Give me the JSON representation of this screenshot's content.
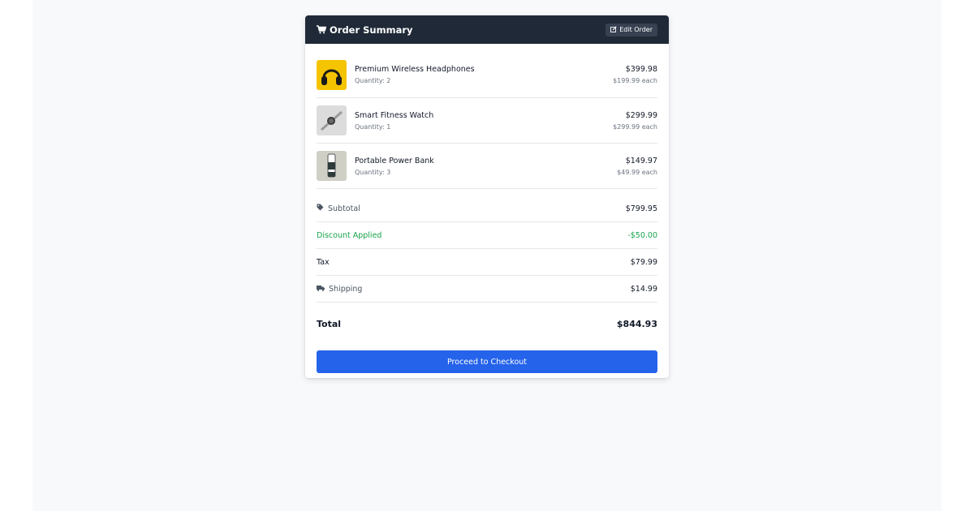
{
  "header": {
    "title": "Order Summary",
    "edit_label": "Edit Order",
    "icons": {
      "cart": "cart-icon",
      "edit": "edit-icon"
    }
  },
  "items": [
    {
      "name": "Premium Wireless Headphones",
      "quantity": "Quantity: 2",
      "total": "$399.98",
      "each": "$199.99 each",
      "image": "headphones-image"
    },
    {
      "name": "Smart Fitness Watch",
      "quantity": "Quantity: 1",
      "total": "$299.99",
      "each": "$299.99 each",
      "image": "watch-image"
    },
    {
      "name": "Portable Power Bank",
      "quantity": "Quantity: 3",
      "total": "$149.97",
      "each": "$49.99 each",
      "image": "power-bank-image"
    }
  ],
  "summary": {
    "subtotal": {
      "label": "Subtotal",
      "value": "$799.95",
      "icon": "tag-icon"
    },
    "discount": {
      "label": "Discount Applied",
      "value": "-$50.00"
    },
    "tax": {
      "label": "Tax",
      "value": "$79.99"
    },
    "shipping": {
      "label": "Shipping",
      "value": "$14.99",
      "icon": "truck-icon"
    },
    "total": {
      "label": "Total",
      "value": "$844.93"
    }
  },
  "checkout_label": "Proceed to Checkout",
  "colors": {
    "header_bg": "#1f2937",
    "accent": "#2563eb",
    "discount": "#16a34a",
    "page_bg": "#f8f9fb"
  }
}
